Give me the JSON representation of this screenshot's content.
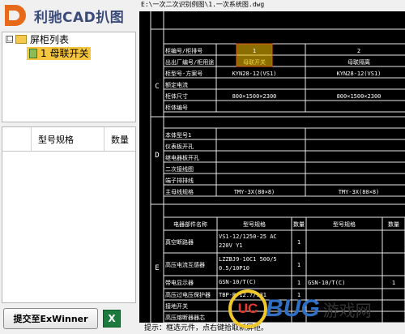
{
  "app": {
    "title": "利驰CAD扒图",
    "logo_letter": "D"
  },
  "tree": {
    "root_toggle": "□",
    "root_label": "屏柜列表",
    "child_label": "1 母联开关"
  },
  "grid": {
    "columns": [
      "型号规格",
      "数量"
    ]
  },
  "buttons": {
    "submit": "提交至ExWinner",
    "excel": "X"
  },
  "drawing": {
    "path": "E:\\一次二次识别例图\\1.一次系统图.dwg",
    "section_labels": [
      "C",
      "D",
      "E"
    ],
    "top_rows": [
      {
        "label": "柜编号/柜排号",
        "c1": "1",
        "c2": "2"
      },
      {
        "label": "出出厂编号/柜用途",
        "c1": "母联开关",
        "c2": "母联隔离"
      },
      {
        "label": "柜型号-方案号",
        "c1": "KYN28-12(VS1)",
        "c2": "KYN28-12(VS1)"
      },
      {
        "label": "额定电流",
        "c1": "",
        "c2": ""
      },
      {
        "label": "柜体尺寸",
        "c1": "800×1500×2300",
        "c2": "800×1500×2300"
      },
      {
        "label": "柜体编号",
        "c1": "",
        "c2": ""
      }
    ],
    "mid_rows": [
      "本体型号1",
      "仪表板开孔",
      "继电器板开孔",
      "二次接线图",
      "端子排排线",
      "主母线规格"
    ],
    "mid_values": [
      "TMY-3X(80×8)",
      "TMY-3X(80×8)"
    ],
    "comp_header": [
      "电器部件名称",
      "型号规格",
      "数量",
      "型号规格",
      "数量"
    ],
    "comp_rows": [
      {
        "name": "真空断路器",
        "spec1": "VS1-12/1250-25 AC 220V Y1",
        "qty1": "1",
        "spec2": "",
        "qty2": ""
      },
      {
        "name": "高压电流互感器",
        "spec1": "LZZBJ9-10C1 500/5 0.5/10P10",
        "qty1": "1",
        "spec2": "",
        "qty2": ""
      },
      {
        "name": "带电显示器",
        "spec1": "GSN-10/T(C)",
        "qty1": "1",
        "spec2": "GSN-10/T(C)",
        "qty2": "1"
      },
      {
        "name": "高压过电压保护器",
        "spec1": "TBP-B-12.7/131",
        "qty1": "1",
        "spec2": "",
        "qty2": ""
      },
      {
        "name": "接地开关",
        "spec1": "",
        "qty1": "",
        "spec2": "",
        "qty2": ""
      },
      {
        "name": "高压熔断器器芯",
        "spec1": "",
        "qty1": "",
        "spec2": "",
        "qty2": ""
      }
    ]
  },
  "status": {
    "hint": "提示：框选元件，点右键拾取新屏柜。"
  },
  "watermark": {
    "uc": "UC",
    "bug": "BUG",
    "cn": "游戏网"
  }
}
